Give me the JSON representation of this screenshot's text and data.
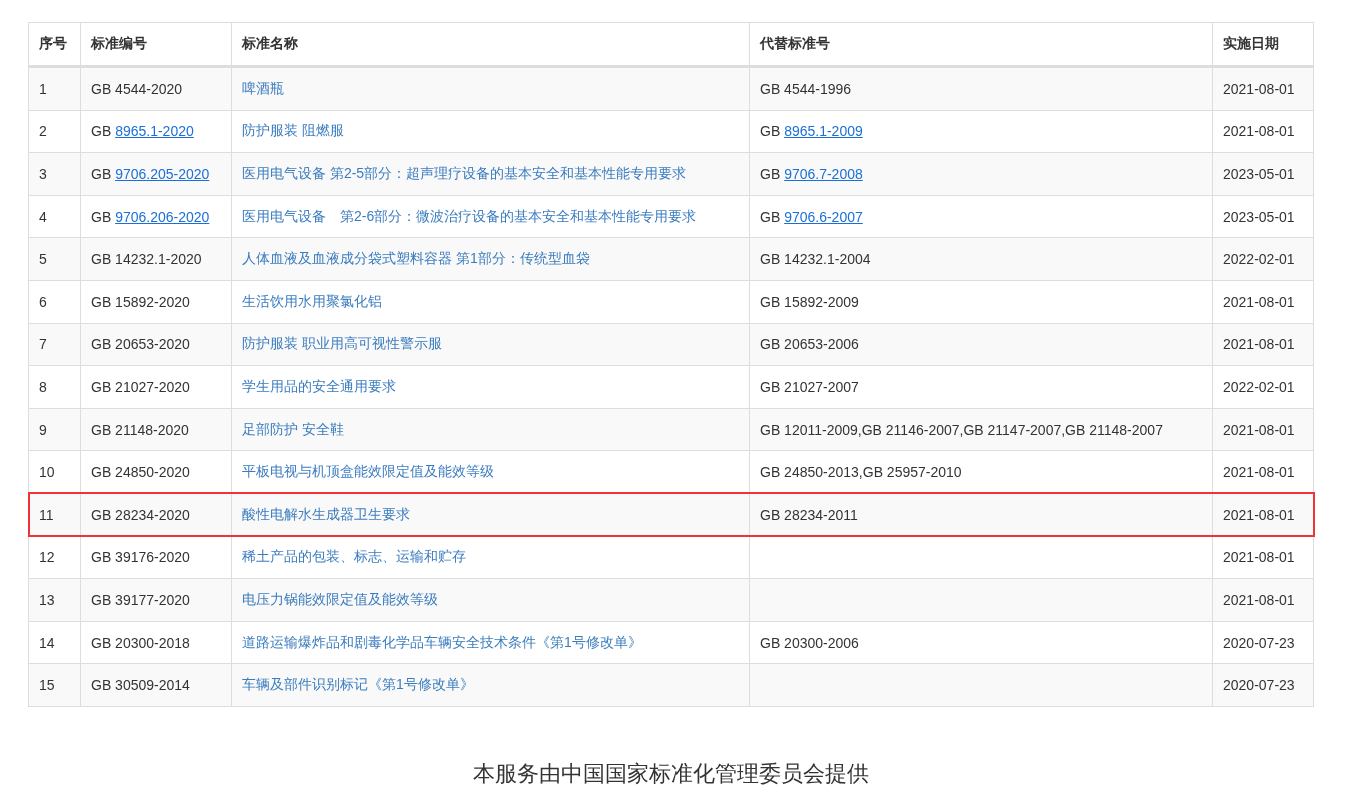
{
  "table": {
    "columns": [
      "序号",
      "标准编号",
      "标准名称",
      "代替标准号",
      "实施日期"
    ],
    "rows": [
      {
        "no": "1",
        "code": {
          "kind": "plain",
          "text": "GB 4544-2020"
        },
        "name": "啤酒瓶",
        "replaces": [
          {
            "kind": "plain",
            "text": "GB 4544-1996"
          }
        ],
        "date": "2021-08-01",
        "highlighted": false
      },
      {
        "no": "2",
        "code": {
          "kind": "link",
          "prefix": "GB",
          "link": "8965.1-2020"
        },
        "name": "防护服装 阻燃服",
        "replaces": [
          {
            "kind": "link",
            "prefix": "GB",
            "link": "8965.1-2009"
          }
        ],
        "date": "2021-08-01",
        "highlighted": false
      },
      {
        "no": "3",
        "code": {
          "kind": "link",
          "prefix": "GB",
          "link": "9706.205-2020"
        },
        "name": "医用电气设备 第2-5部分：超声理疗设备的基本安全和基本性能专用要求",
        "replaces": [
          {
            "kind": "link",
            "prefix": "GB",
            "link": "9706.7-2008"
          }
        ],
        "date": "2023-05-01",
        "highlighted": false
      },
      {
        "no": "4",
        "code": {
          "kind": "link",
          "prefix": "GB",
          "link": "9706.206-2020"
        },
        "name": "医用电气设备　第2-6部分：微波治疗设备的基本安全和基本性能专用要求",
        "replaces": [
          {
            "kind": "link",
            "prefix": "GB",
            "link": "9706.6-2007"
          }
        ],
        "date": "2023-05-01",
        "highlighted": false
      },
      {
        "no": "5",
        "code": {
          "kind": "plain",
          "text": "GB 14232.1-2020"
        },
        "name": "人体血液及血液成分袋式塑料容器 第1部分：传统型血袋",
        "replaces": [
          {
            "kind": "plain",
            "text": "GB 14232.1-2004"
          }
        ],
        "date": "2022-02-01",
        "highlighted": false
      },
      {
        "no": "6",
        "code": {
          "kind": "plain",
          "text": "GB 15892-2020"
        },
        "name": "生活饮用水用聚氯化铝",
        "replaces": [
          {
            "kind": "plain",
            "text": "GB 15892-2009"
          }
        ],
        "date": "2021-08-01",
        "highlighted": false
      },
      {
        "no": "7",
        "code": {
          "kind": "plain",
          "text": "GB 20653-2020"
        },
        "name": "防护服装 职业用高可视性警示服",
        "replaces": [
          {
            "kind": "plain",
            "text": "GB 20653-2006"
          }
        ],
        "date": "2021-08-01",
        "highlighted": false
      },
      {
        "no": "8",
        "code": {
          "kind": "plain",
          "text": "GB 21027-2020"
        },
        "name": "学生用品的安全通用要求",
        "replaces": [
          {
            "kind": "plain",
            "text": "GB 21027-2007"
          }
        ],
        "date": "2022-02-01",
        "highlighted": false
      },
      {
        "no": "9",
        "code": {
          "kind": "plain",
          "text": "GB 21148-2020"
        },
        "name": "足部防护 安全鞋",
        "replaces": [
          {
            "kind": "plain",
            "text": "GB 12011-2009,GB 21146-2007,GB 21147-2007,GB 21148-2007"
          }
        ],
        "date": "2021-08-01",
        "highlighted": false
      },
      {
        "no": "10",
        "code": {
          "kind": "plain",
          "text": "GB 24850-2020"
        },
        "name": "平板电视与机顶盒能效限定值及能效等级",
        "replaces": [
          {
            "kind": "plain",
            "text": "GB 24850-2013,GB 25957-2010"
          }
        ],
        "date": "2021-08-01",
        "highlighted": false
      },
      {
        "no": "11",
        "code": {
          "kind": "plain",
          "text": "GB 28234-2020"
        },
        "name": "酸性电解水生成器卫生要求",
        "replaces": [
          {
            "kind": "plain",
            "text": "GB 28234-2011"
          }
        ],
        "date": "2021-08-01",
        "highlighted": true
      },
      {
        "no": "12",
        "code": {
          "kind": "plain",
          "text": "GB 39176-2020"
        },
        "name": "稀土产品的包装、标志、运输和贮存",
        "replaces": [],
        "date": "2021-08-01",
        "highlighted": false
      },
      {
        "no": "13",
        "code": {
          "kind": "plain",
          "text": "GB 39177-2020"
        },
        "name": "电压力锅能效限定值及能效等级",
        "replaces": [],
        "date": "2021-08-01",
        "highlighted": false
      },
      {
        "no": "14",
        "code": {
          "kind": "plain",
          "text": "GB 20300-2018"
        },
        "name": "道路运输爆炸品和剧毒化学品车辆安全技术条件《第1号修改单》",
        "replaces": [
          {
            "kind": "plain",
            "text": "GB 20300-2006"
          }
        ],
        "date": "2020-07-23",
        "highlighted": false
      },
      {
        "no": "15",
        "code": {
          "kind": "plain",
          "text": "GB 30509-2014"
        },
        "name": "车辆及部件识别标记《第1号修改单》",
        "replaces": [],
        "date": "2020-07-23",
        "highlighted": false
      }
    ]
  },
  "footer": {
    "text": "本服务由中国国家标准化管理委员会提供"
  }
}
